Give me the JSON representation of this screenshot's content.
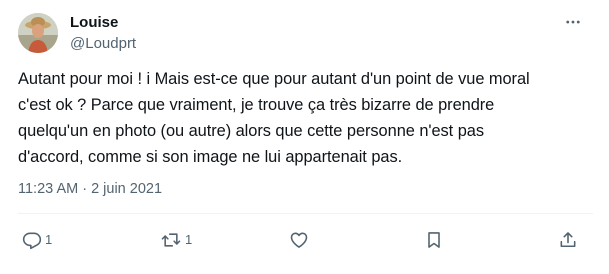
{
  "author": {
    "display_name": "Louise",
    "handle": "@Loudprt"
  },
  "tweet": {
    "text": "Autant pour moi ! i Mais est-ce que pour autant d'un point de vue moral\nc'est ok ? Parce que vraiment, je trouve ça très bizarre de prendre\nquelqu'un en photo (ou autre) alors que cette personne n'est pas\nd'accord, comme si son image ne lui appartenait pas.",
    "timestamp": "11:23 AM · 2 juin 2021"
  },
  "actions": {
    "reply_count": "1",
    "retweet_count": "1"
  },
  "icons": {
    "more": "more-horizontal-icon",
    "reply": "reply-icon",
    "retweet": "retweet-icon",
    "like": "heart-icon",
    "bookmark": "bookmark-icon",
    "share": "share-icon"
  },
  "colors": {
    "text": "#0f1419",
    "secondary": "#536471",
    "divider": "#eff3f4"
  }
}
